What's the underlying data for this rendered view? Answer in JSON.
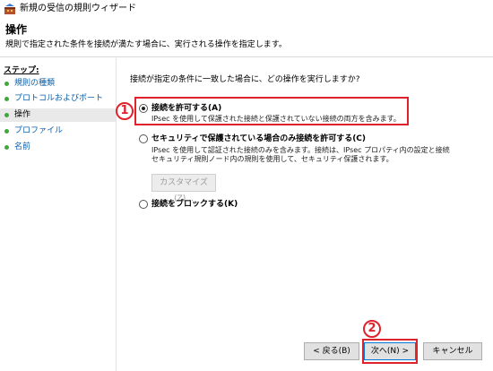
{
  "window": {
    "title": "新規の受信の規則ウィザード",
    "icon": "firewall-wizard-icon"
  },
  "header": {
    "title": "操作",
    "subtitle": "規則で指定された条件を接続が満たす場合に、実行される操作を指定します。"
  },
  "sidebar": {
    "heading": "ステップ:",
    "items": [
      {
        "label": "規則の種類"
      },
      {
        "label": "プロトコルおよびポート"
      },
      {
        "label": "操作"
      },
      {
        "label": "プロファイル"
      },
      {
        "label": "名前"
      }
    ]
  },
  "main": {
    "question": "接続が指定の条件に一致した場合に、どの操作を実行しますか?",
    "options": [
      {
        "label": "接続を許可する(A)",
        "description": [
          "IPsec を使用して保護された接続と保護されていない接続の両方を含みます。"
        ],
        "selected": true
      },
      {
        "label": "セキュリティで保護されている場合のみ接続を許可する(C)",
        "description": [
          "IPsec を使用して認証された接続のみを含みます。接続は、IPsec プロパティ内の設定と接続",
          "セキュリティ規則ノード内の規則を使用して、セキュリティ保護されます。"
        ],
        "selected": false
      },
      {
        "label": "接続をブロックする(K)",
        "description": [],
        "selected": false
      }
    ],
    "customize_label": "カスタマイズ(Z)..."
  },
  "footer": {
    "back_label": "< 戻る(B)",
    "next_label": "次へ(N) >",
    "cancel_label": "キャンセル"
  },
  "annotations": {
    "marker_1": "1",
    "marker_2": "2"
  },
  "colors": {
    "accent": "#0078d7",
    "annotation_red": "#e0222b",
    "link": "#0d5fa8",
    "step_bullet": "#3da93d"
  }
}
